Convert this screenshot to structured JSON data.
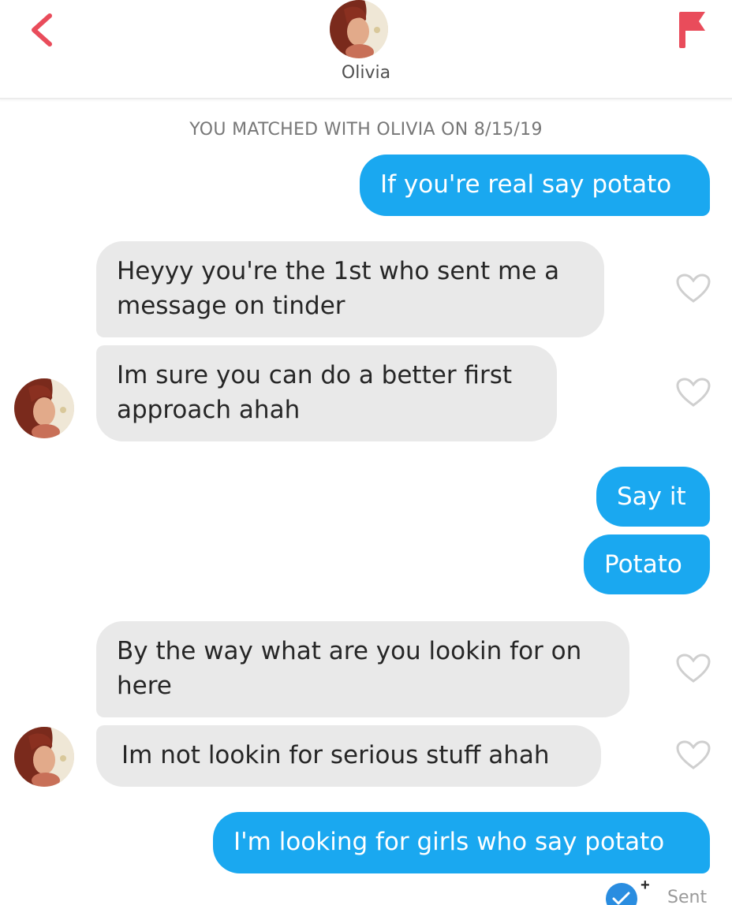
{
  "header": {
    "name": "Olivia",
    "back_icon": "chevron-left-icon",
    "report_icon": "flag-icon",
    "accent_color": "#e94c5b"
  },
  "match_banner": "YOU MATCHED WITH OLIVIA ON 8/15/19",
  "messages": [
    {
      "from": "me",
      "text": "If you're real say potato"
    },
    {
      "from": "olivia",
      "lines": [
        "Heyyy you're the 1st who sent me a",
        "message on tinder"
      ]
    },
    {
      "from": "olivia",
      "lines": [
        "Im sure you can do a better first",
        "approach ahah"
      ]
    },
    {
      "from": "me",
      "text": "Say it"
    },
    {
      "from": "me",
      "text": "Potato"
    },
    {
      "from": "olivia",
      "lines": [
        "By the way what are you lookin for on",
        "here"
      ]
    },
    {
      "from": "olivia",
      "text": "Im not lookin for serious stuff ahah"
    },
    {
      "from": "me",
      "text": "I'm looking for girls who say potato"
    }
  ],
  "status": {
    "plus": "+",
    "text": "Sent"
  },
  "colors": {
    "sent_bubble": "#1aa8f0",
    "received_bubble": "#e9e9e9",
    "heart_outline": "#cfcfcf"
  }
}
